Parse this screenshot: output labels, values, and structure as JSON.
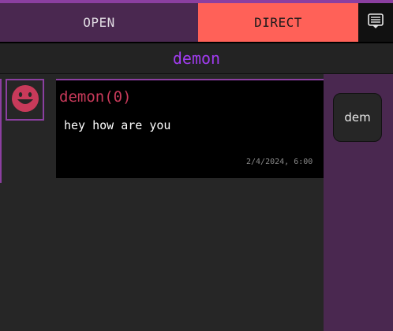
{
  "tabs": {
    "open_label": "OPEN",
    "direct_label": "DIRECT",
    "menu_icon": "chat-list-icon"
  },
  "channel": {
    "title": "demon"
  },
  "messages": [
    {
      "author": "demon(0)",
      "text": "hey how are you",
      "timestamp": "2/4/2024, 6:00",
      "avatar_icon": "smiley-face-icon"
    }
  ],
  "sidebar": {
    "users": [
      {
        "label": "dem"
      }
    ]
  },
  "colors": {
    "accent_purple": "#8b3fa0",
    "tab_active": "#ff6158",
    "tab_inactive": "#4a2850",
    "channel_title": "#a13cf0",
    "author": "#c83a5a"
  }
}
